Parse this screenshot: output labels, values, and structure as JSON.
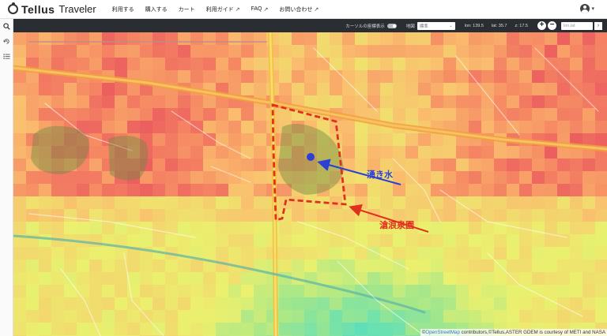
{
  "app": {
    "brand": "Tellus",
    "product": "Traveler"
  },
  "nav": [
    {
      "label": "利用する",
      "external": false
    },
    {
      "label": "購入する",
      "external": false
    },
    {
      "label": "カート",
      "external": false
    },
    {
      "label": "利用ガイド",
      "external": true
    },
    {
      "label": "FAQ",
      "external": true
    },
    {
      "label": "お問い合わせ",
      "external": true
    }
  ],
  "sidebar": {
    "icons": [
      "search-icon",
      "history-icon",
      "layers-list-icon"
    ]
  },
  "toolbar": {
    "cursor_position_label": "カーソルの座標表示",
    "basemap_label": "地図",
    "basemap_value": "標準",
    "lon": "lon: 139.5",
    "lat": "lat: 35.7",
    "zoom": "z: 17.5",
    "zoom_in": "+",
    "zoom_out": "−",
    "latlon_placeholder": "lon,lat",
    "go": "›"
  },
  "map": {
    "annotations": {
      "spring": "湧き水",
      "garden": "滄浪泉園"
    },
    "annotation_colors": {
      "spring": "#2e3fd6",
      "garden": "#e0301e"
    },
    "attribution_link": "OpenStreetMap",
    "attribution_prefix": "©",
    "attribution_suffix": " contributors,©Tellus,ASTER GDEM is courtesy of METI and NASA"
  },
  "colors": {
    "toolbar_bg": "#2a2e33",
    "accent_blue": "#2e3fd6",
    "accent_red": "#e0301e"
  }
}
